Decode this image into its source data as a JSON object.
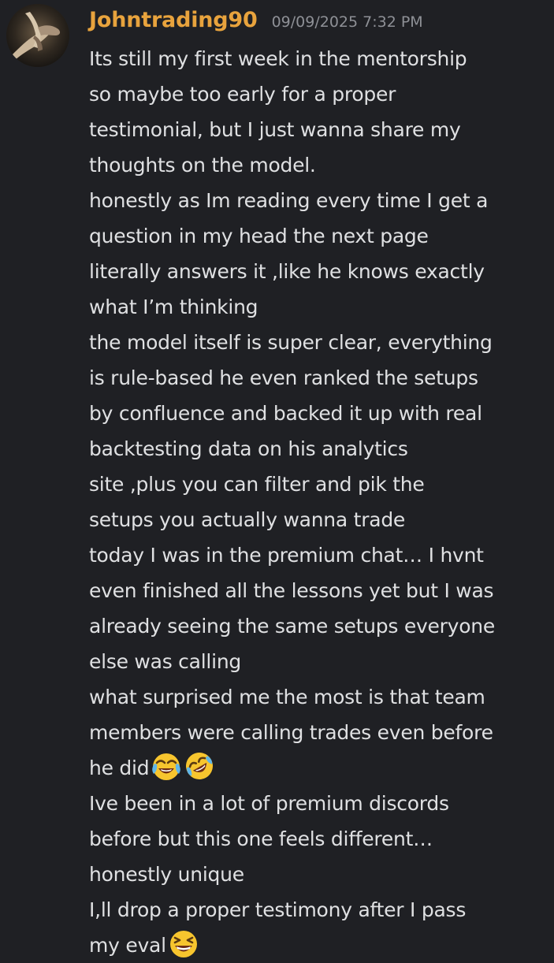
{
  "message": {
    "author": "Johntrading90",
    "timestamp": "09/09/2025 7:32 PM",
    "colors": {
      "author": "#e8a33d",
      "timestamp": "#8e9096",
      "text": "#dfe0e2",
      "background": "#1f2024"
    },
    "avatar_icon": "hands-holding-avatar",
    "lines": [
      "Its still my first week in the mentorship",
      "so maybe too early for a proper",
      "testimonial, but I just wanna share my",
      "thoughts on the model.",
      "honestly as Im reading every time I get a",
      "question in my head the next page",
      "literally answers it ,like he knows exactly",
      "what I’m thinking",
      "the model itself is super clear, everything",
      "is rule-based he even ranked the setups",
      "by confluence and backed it up with real",
      "backtesting data on his analytics",
      "site ,plus you can filter and pik the",
      "setups you actually wanna trade",
      "today I was in the premium chat… I hvnt",
      "even finished all the lessons yet but I was",
      "already seeing the same setups everyone",
      "else was calling",
      "what surprised me the most is that team",
      "members were calling trades even before",
      "he did",
      "Ive been in a lot of premium discords",
      "before but this one feels different…",
      "honestly unique",
      "I,ll drop a proper testimony after I pass",
      "my eval"
    ],
    "emojis": {
      "line_21": [
        "face-with-tears-of-joy-emoji",
        "rolling-on-floor-laughing-emoji"
      ],
      "line_26": [
        "grinning-squinting-face-emoji"
      ]
    }
  }
}
